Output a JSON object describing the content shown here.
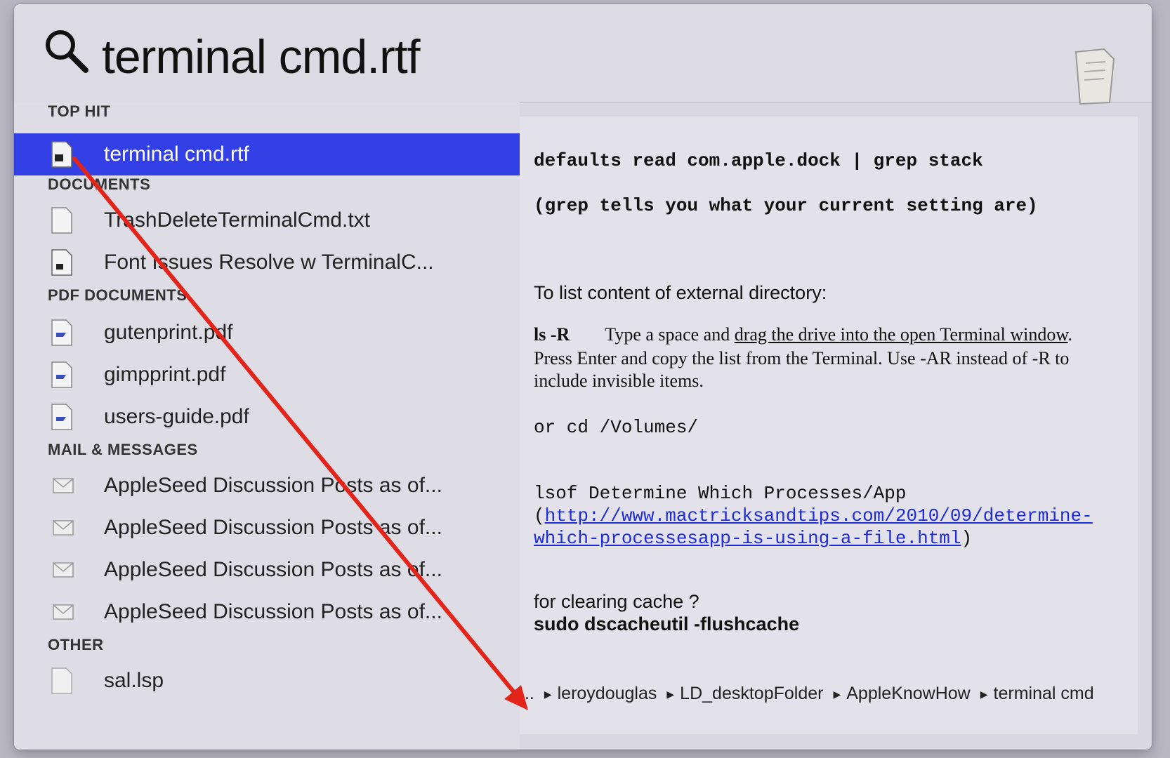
{
  "search": {
    "query": "terminal cmd.rtf"
  },
  "sections": {
    "top_hit": "TOP HIT",
    "documents": "DOCUMENTS",
    "pdf_documents": "PDF DOCUMENTS",
    "mail_messages": "MAIL & MESSAGES",
    "other": "OTHER"
  },
  "results": {
    "top_hit": "terminal cmd.rtf",
    "documents": [
      "TrashDeleteTerminalCmd.txt",
      "Font Issues Resolve w TerminalC..."
    ],
    "pdf_documents": [
      "gutenprint.pdf",
      "gimpprint.pdf",
      "users-guide.pdf"
    ],
    "mail_messages": [
      "AppleSeed Discussion Posts as of...",
      "AppleSeed Discussion Posts as of...",
      "AppleSeed Discussion Posts as of...",
      "AppleSeed Discussion Posts as of..."
    ],
    "other": [
      "sal.lsp"
    ]
  },
  "preview": {
    "line1": "defaults read com.apple.dock | grep stack",
    "line2": "(grep tells you what your current setting are)",
    "line3": "To list content of external directory:",
    "ls_cmd": "ls -R",
    "ls_text_a": "Type a space and ",
    "ls_text_link": "drag the drive into the open Terminal window",
    "ls_text_b": ".",
    "ls_line2": "Press Enter and copy the list from the Terminal. Use -AR instead of -R to",
    "ls_line3": "include invisible items.",
    "or_line": "or  cd /Volumes/",
    "lsof_line": "lsof   Determine Which Processes/App",
    "url_open": "(",
    "url_part1": "http://www.mactricksandtips.com/2010/09/determine-",
    "url_part2": "which-processesapp-is-using-a-file.html",
    "url_close": ")",
    "cache_line": "for clearing cache ?",
    "cache_cmd": "sudo dscacheutil -flushcache"
  },
  "path": [
    "...",
    "leroydouglas",
    "LD_desktopFolder",
    "AppleKnowHow",
    "terminal cmd"
  ],
  "colors": {
    "selection": "#3240e6",
    "link": "#1d2bd8",
    "annotation_arrow": "#e3241b"
  }
}
